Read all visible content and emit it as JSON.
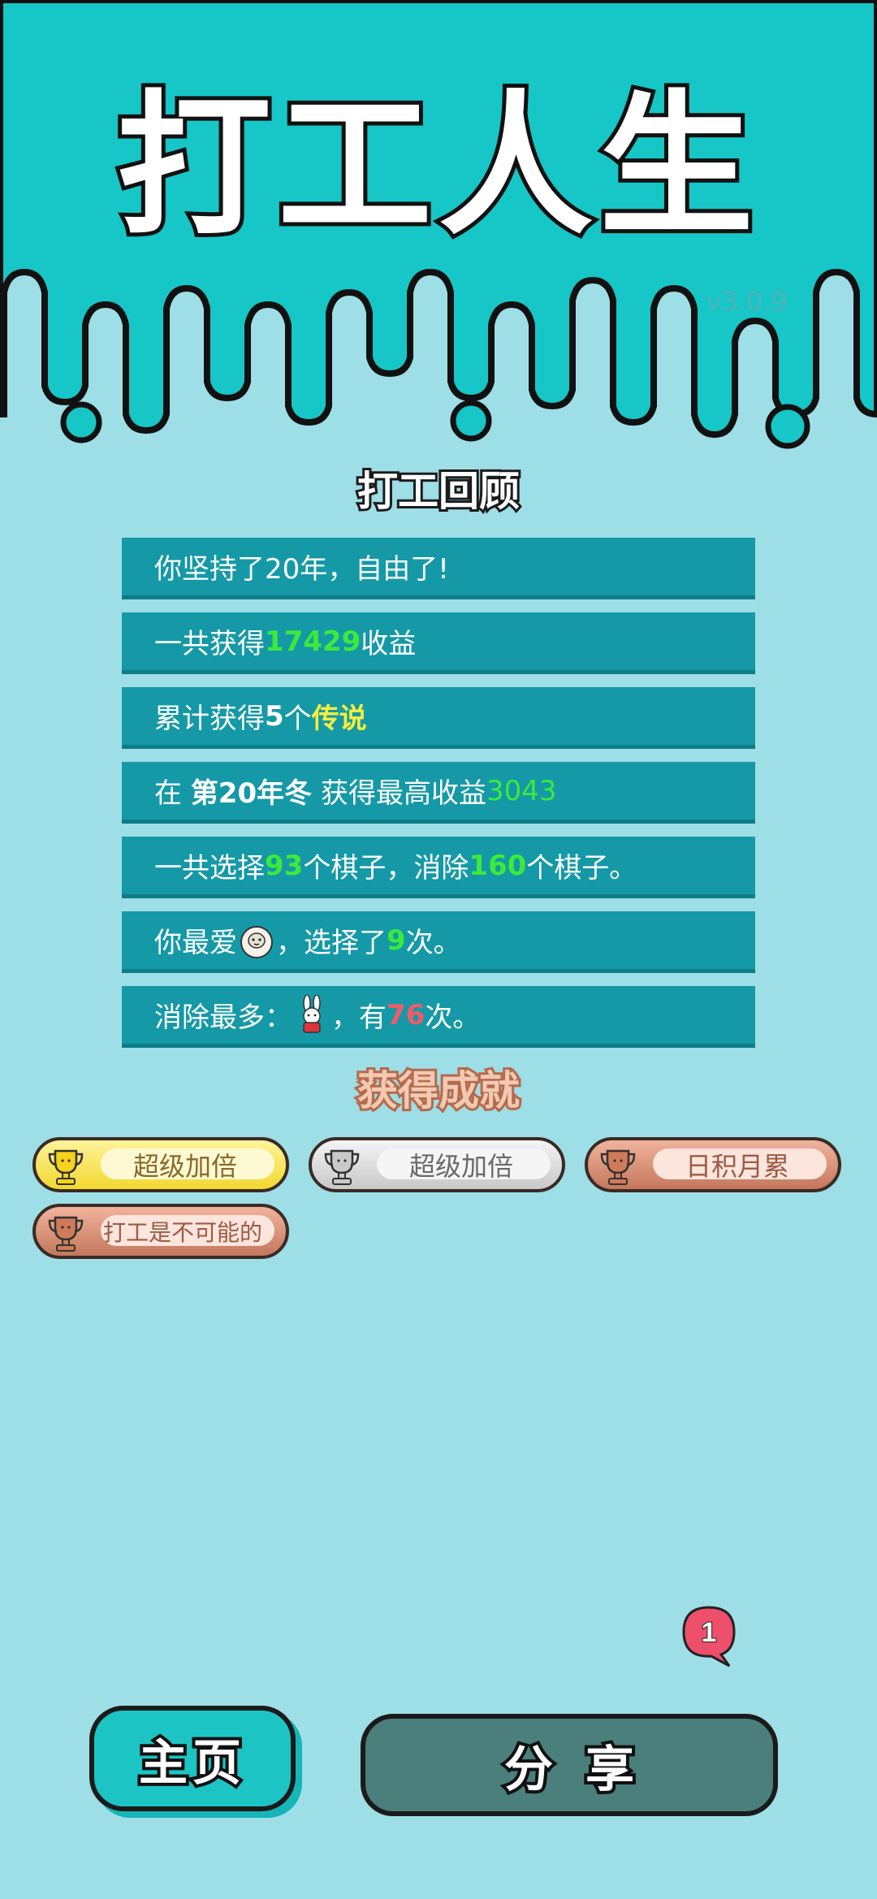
{
  "header": {
    "title": "打工人生",
    "version": "v3.0.9"
  },
  "review": {
    "heading": "打工回顾",
    "row1": {
      "text": "你坚持了20年，自由了!"
    },
    "row2": {
      "pre": "一共获得",
      "value": "17429",
      "post": "收益"
    },
    "row3": {
      "pre": "累计获得",
      "count": "5",
      "mid": "个",
      "rarity": "传说"
    },
    "row4": {
      "pre": "在 ",
      "season": "第20年冬",
      "mid": " 获得最高收益",
      "value": "3043"
    },
    "row5": {
      "pre": "一共选择",
      "chosen": "93",
      "mid": "个棋子，消除",
      "removed": "160",
      "post": "个棋子。"
    },
    "row6": {
      "pre": "你最爱",
      "mid": "，选择了",
      "times": "9",
      "post": "次。"
    },
    "row7": {
      "pre": "消除最多：",
      "mid": "，有",
      "times": "76",
      "post": "次。"
    }
  },
  "achievements": {
    "heading": "获得成就",
    "items": [
      {
        "label": "超级加倍",
        "tier": "gold"
      },
      {
        "label": "超级加倍",
        "tier": "silver"
      },
      {
        "label": "日积月累",
        "tier": "bronze"
      },
      {
        "label": "打工是不可能的",
        "tier": "bronze"
      }
    ]
  },
  "notification": {
    "count": "1"
  },
  "buttons": {
    "home": "主页",
    "share": "分享"
  },
  "colors": {
    "background": "#9edee6",
    "header": "#17c6c6",
    "row": "#1599a7",
    "highlight_green": "#3bea3b",
    "highlight_yellow": "#f4ef3d",
    "highlight_red": "#f05a6a"
  }
}
